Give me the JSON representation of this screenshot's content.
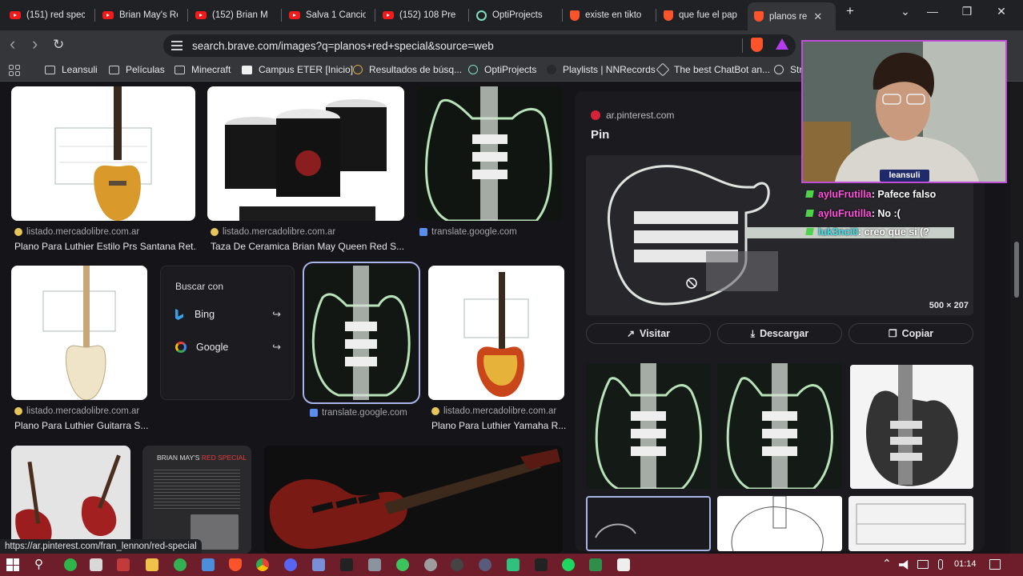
{
  "tabs": [
    {
      "label": "(151) red spec",
      "icon": "youtube-icon"
    },
    {
      "label": "Brian May's Re",
      "icon": "youtube-icon"
    },
    {
      "label": "(152) Brian M",
      "icon": "youtube-icon"
    },
    {
      "label": "Salva 1 Cancio",
      "icon": "youtube-icon"
    },
    {
      "label": "(152) 108 Pre",
      "icon": "youtube-icon"
    },
    {
      "label": "OptiProjects",
      "icon": "optiprojects-icon"
    },
    {
      "label": "existe en tikto",
      "icon": "brave-icon"
    },
    {
      "label": "que fue el pap",
      "icon": "brave-icon"
    },
    {
      "label": "planos re",
      "icon": "brave-icon",
      "active": true
    }
  ],
  "window": {
    "new_tab": "+",
    "dropdown": "⌄",
    "minimize": "—",
    "restore": "❐",
    "close": "✕",
    "tab_close": "✕"
  },
  "nav": {
    "back": "‹",
    "forward": "›",
    "reload": "↻"
  },
  "url": "search.brave.com/images?q=planos+red+special&source=web",
  "bookmarks": [
    {
      "label": "Leansuli",
      "icon": "folder-icon"
    },
    {
      "label": "Películas",
      "icon": "folder-icon"
    },
    {
      "label": "Minecraft",
      "icon": "folder-icon"
    },
    {
      "label": "Campus ETER [Inicio]",
      "icon": "campus-icon"
    },
    {
      "label": "Resultados de búsq...",
      "icon": "search-result-icon"
    },
    {
      "label": "OptiProjects",
      "icon": "optiprojects-icon"
    },
    {
      "label": "Playlists | NNRecords",
      "icon": "nnrecords-icon"
    },
    {
      "label": "The best ChatBot an...",
      "icon": "chatbot-icon"
    },
    {
      "label": "Str",
      "icon": "steam-icon"
    }
  ],
  "results": {
    "row1": [
      {
        "source": "listado.mercadolibre.com.ar",
        "caption": "Plano Para Luthier Estilo Prs Santana Ret..."
      },
      {
        "source": "listado.mercadolibre.com.ar",
        "caption": "Taza De Ceramica Brian May Queen Red S..."
      },
      {
        "source": "translate.google.com",
        "caption": ""
      }
    ],
    "row2": [
      {
        "source": "listado.mercadolibre.com.ar",
        "caption": "Plano Para Luthier Guitarra S..."
      },
      {
        "source": "translate.google.com",
        "caption": ""
      },
      {
        "source": "listado.mercadolibre.com.ar",
        "caption": "Plano Para Luthier Yamaha R..."
      }
    ],
    "row3_poster_text": {
      "line1": "BRIAN MAY'S",
      "line2": "RED SPECIAL"
    }
  },
  "search_with": {
    "title": "Buscar con",
    "engines": [
      {
        "label": "Bing",
        "icon": "bing-icon"
      },
      {
        "label": "Google",
        "icon": "google-icon"
      }
    ],
    "share_icon": "↪"
  },
  "panel": {
    "source": "ar.pinterest.com",
    "title": "Pin",
    "dimensions": "500 × 207",
    "actions": [
      {
        "label": "Visitar",
        "icon": "↗"
      },
      {
        "label": "Descargar",
        "icon": "⤓"
      },
      {
        "label": "Copiar",
        "icon": "❐"
      }
    ]
  },
  "webcam": {
    "name": "leansuli"
  },
  "chat": [
    {
      "user": "ayluFrutilla",
      "message": ": Pafece falso"
    },
    {
      "user": "ayluFrutilla",
      "message": ": No :("
    },
    {
      "user": "luk3nci0",
      "message": ": creo que si (?"
    }
  ],
  "status_url": "https://ar.pinterest.com/fran_lennon/red-special",
  "taskbar": {
    "time": "01:14",
    "search_icon": "⚲",
    "tray_chevron": "⌃"
  },
  "colors": {
    "accent": "#a8b3e6",
    "taskbar": "#6e1d2b",
    "webcam_border": "#c04fd8",
    "chat_user1": "#ff4fd7",
    "chat_user2": "#3be0e8"
  }
}
